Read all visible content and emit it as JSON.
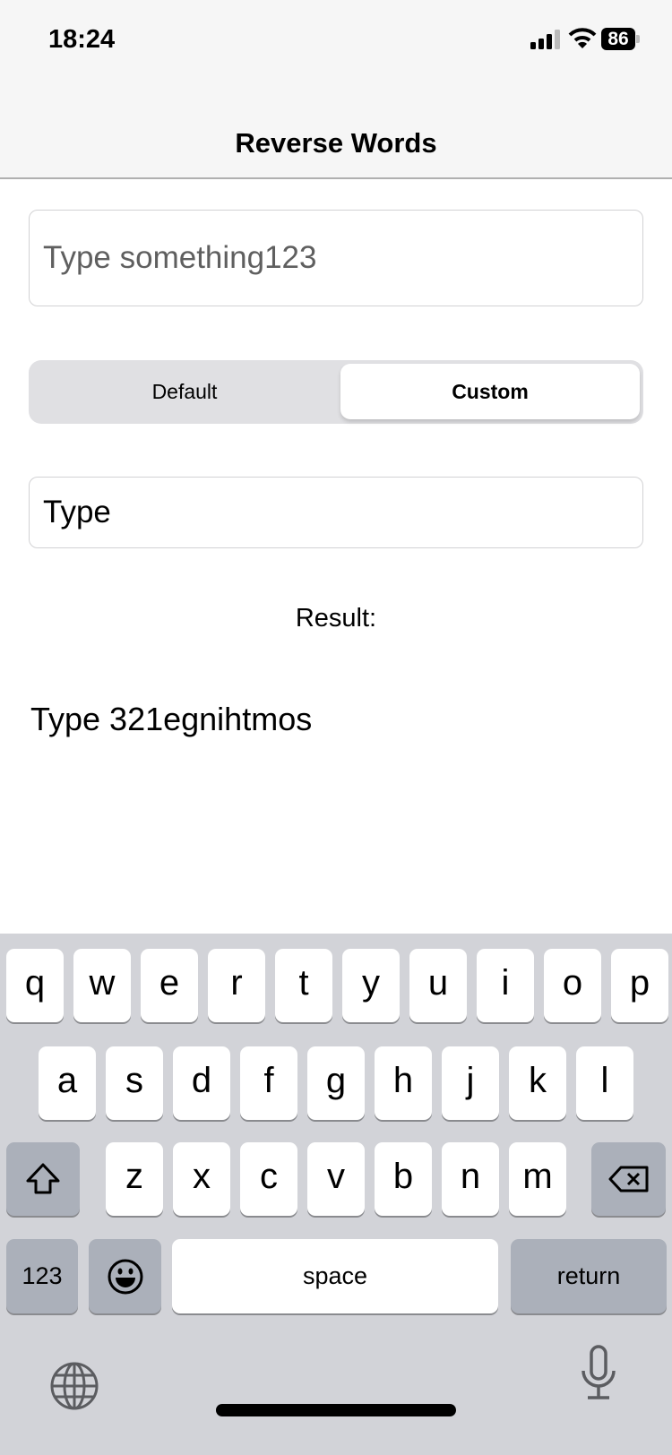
{
  "status_bar": {
    "time": "18:24",
    "battery": "86",
    "icons": [
      "signal-icon",
      "wifi-icon",
      "battery-icon"
    ]
  },
  "nav": {
    "title": "Reverse Words"
  },
  "input": {
    "value": "Type something123"
  },
  "segmented": {
    "options": [
      "Default",
      "Custom"
    ],
    "selected": "Custom"
  },
  "custom_input": {
    "value": "Type"
  },
  "result": {
    "label": "Result:",
    "value": "Type 321egnihtmos"
  },
  "keyboard": {
    "row1": [
      "q",
      "w",
      "e",
      "r",
      "t",
      "y",
      "u",
      "i",
      "o",
      "p"
    ],
    "row2": [
      "a",
      "s",
      "d",
      "f",
      "g",
      "h",
      "j",
      "k",
      "l"
    ],
    "row3": [
      "z",
      "x",
      "c",
      "v",
      "b",
      "n",
      "m"
    ],
    "numbers": "123",
    "space": "space",
    "return": "return",
    "icons": [
      "shift-icon",
      "delete-icon",
      "emoji-icon",
      "globe-icon",
      "microphone-icon"
    ]
  }
}
